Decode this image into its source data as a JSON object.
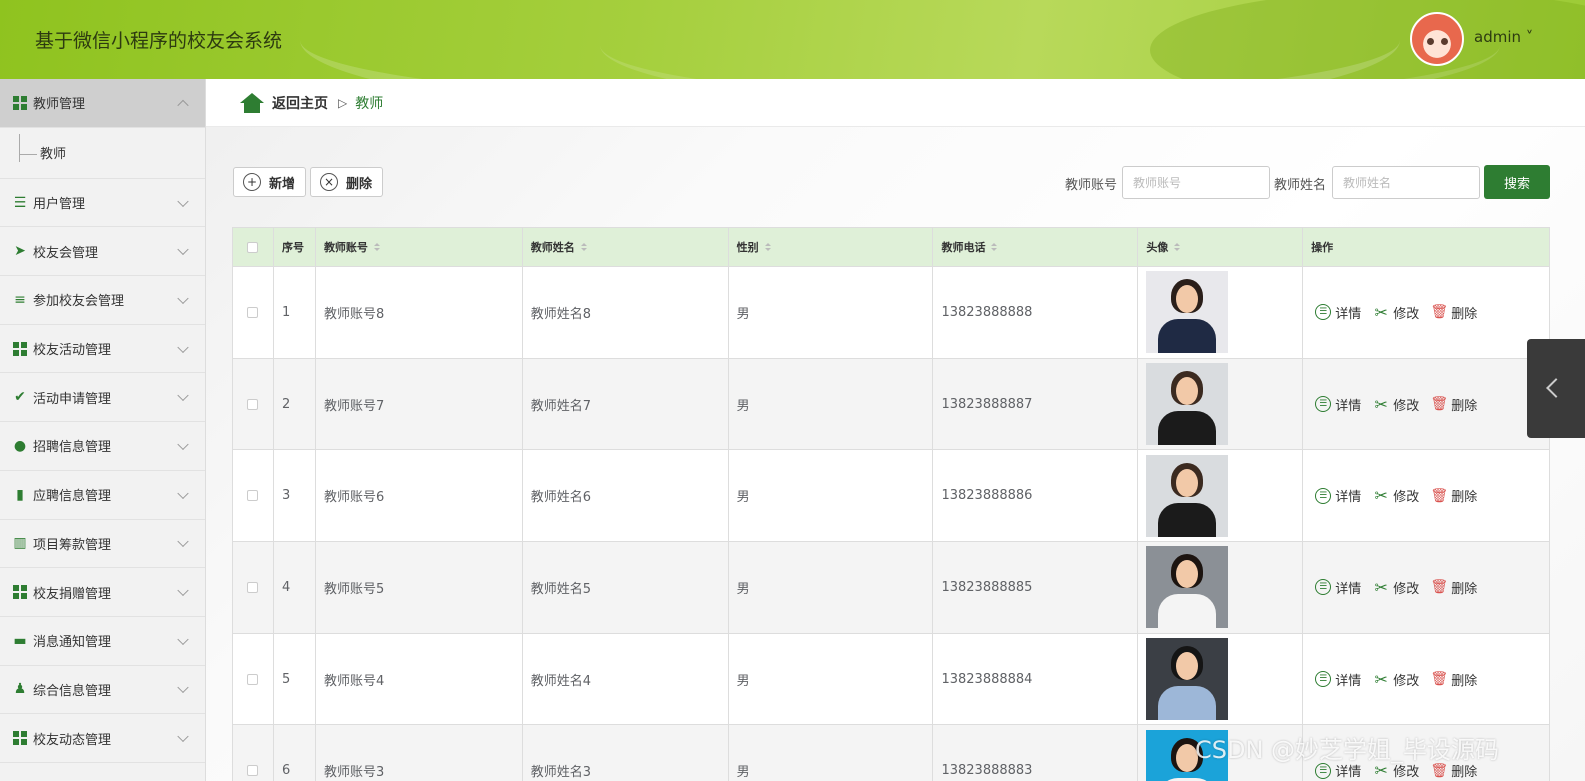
{
  "header": {
    "title": "基于微信小程序的校友会系统",
    "user": "admin ˅"
  },
  "sidebar": {
    "items": [
      {
        "label": "教师管理",
        "icon": "grid-icon",
        "expanded": true
      },
      {
        "label": "用户管理",
        "icon": "sliders-icon"
      },
      {
        "label": "校友会管理",
        "icon": "paper-plane-icon"
      },
      {
        "label": "参加校友会管理",
        "icon": "list-icon"
      },
      {
        "label": "校友活动管理",
        "icon": "grid-icon"
      },
      {
        "label": "活动申请管理",
        "icon": "clipboard-check-icon"
      },
      {
        "label": "招聘信息管理",
        "icon": "balloon-icon"
      },
      {
        "label": "应聘信息管理",
        "icon": "book-icon"
      },
      {
        "label": "项目筹款管理",
        "icon": "bar-chart-icon"
      },
      {
        "label": "校友捐赠管理",
        "icon": "grid-icon"
      },
      {
        "label": "消息通知管理",
        "icon": "ticket-icon"
      },
      {
        "label": "综合信息管理",
        "icon": "user-stamp-icon"
      },
      {
        "label": "校友动态管理",
        "icon": "grid-icon"
      }
    ],
    "submenu": "教师"
  },
  "breadcrumb": {
    "home": "返回主页",
    "sep": "▷",
    "current": "教师"
  },
  "toolbar": {
    "add_label": "新增",
    "delete_label": "删除"
  },
  "search": {
    "account_label": "教师账号",
    "account_placeholder": "教师账号",
    "name_label": "教师姓名",
    "name_placeholder": "教师姓名",
    "button": "搜索"
  },
  "table": {
    "headers": [
      "序号",
      "教师账号",
      "教师姓名",
      "性别",
      "教师电话",
      "头像",
      "操作"
    ],
    "rows": [
      {
        "no": "1",
        "account": "教师账号8",
        "name": "教师姓名8",
        "gender": "男",
        "phone": "13823888888"
      },
      {
        "no": "2",
        "account": "教师账号7",
        "name": "教师姓名7",
        "gender": "男",
        "phone": "13823888887"
      },
      {
        "no": "3",
        "account": "教师账号6",
        "name": "教师姓名6",
        "gender": "男",
        "phone": "13823888886"
      },
      {
        "no": "4",
        "account": "教师账号5",
        "name": "教师姓名5",
        "gender": "男",
        "phone": "13823888885"
      },
      {
        "no": "5",
        "account": "教师账号4",
        "name": "教师姓名4",
        "gender": "男",
        "phone": "13823888884"
      },
      {
        "no": "6",
        "account": "教师账号3",
        "name": "教师姓名3",
        "gender": "男",
        "phone": "13823888883"
      }
    ],
    "actions": {
      "detail": "详情",
      "edit": "修改",
      "remove": "删除"
    }
  },
  "watermark": "CSDN @妙芝学姐_毕设源码",
  "colors": {
    "accent": "#2e7d32",
    "header": "#a5cf3d",
    "table_header": "#dff0d8"
  }
}
